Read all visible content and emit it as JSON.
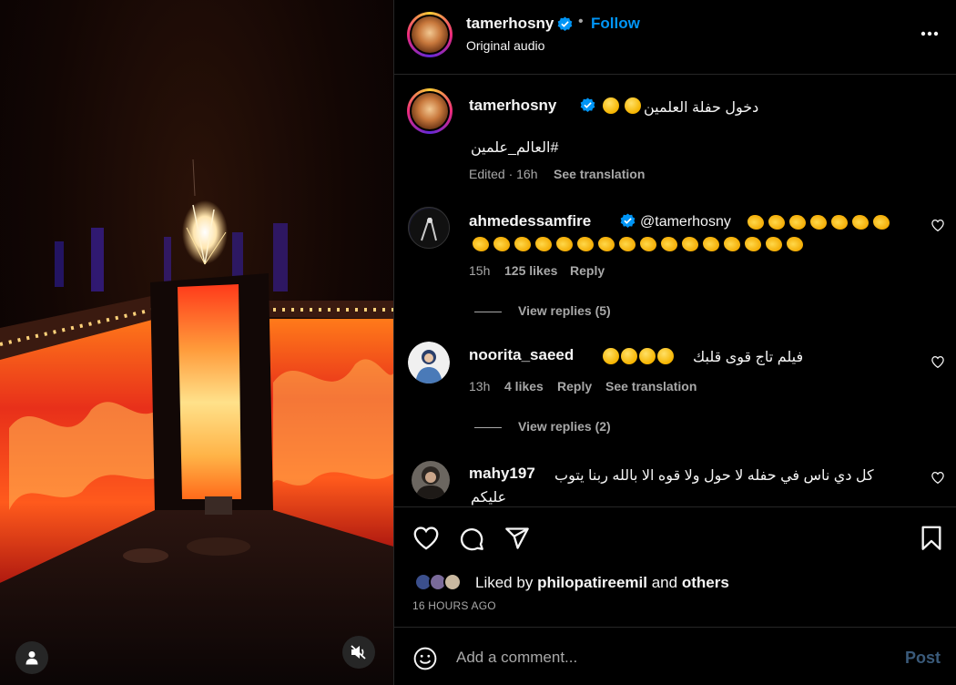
{
  "post": {
    "author": "tamerhosny",
    "follow_label": "Follow",
    "separator": "•",
    "audio": "Original audio"
  },
  "caption": {
    "author": "tamerhosny",
    "text": "دخول حفلة العلمين",
    "hashtag": "#العالم_علمين",
    "edited": "Edited · 16h",
    "see_translation": "See translation"
  },
  "comments": [
    {
      "user": "ahmedessamfire",
      "mention": "@tamerhosny",
      "time": "15h",
      "likes": "125 likes",
      "reply": "Reply",
      "view_replies": "View replies (5)"
    },
    {
      "user": "noorita_saeed",
      "text": "فيلم تاج قوى قلبك",
      "time": "13h",
      "likes": "4 likes",
      "reply": "Reply",
      "see_translation": "See translation",
      "view_replies": "View replies (2)"
    },
    {
      "user": "mahy197",
      "text_line1": "كل دي ناس في حفله لا حول ولا قوه الا بالله ربنا يتوب",
      "text_line2": "عليكم"
    }
  ],
  "likes": {
    "prefix": "Liked by",
    "user": "philopatireemil",
    "and": "and",
    "others": "others",
    "timestamp": "16 HOURS AGO"
  },
  "composer": {
    "placeholder": "Add a comment...",
    "post_label": "Post"
  },
  "colors": {
    "accent": "#0095f6",
    "verified": "#0095f6",
    "muted_text": "#a8a8a8",
    "divider": "#262626"
  },
  "icons": [
    "more-icon",
    "verified-icon",
    "heart-icon",
    "comment-icon",
    "share-icon",
    "bookmark-icon",
    "emoji-icon",
    "user-tag-icon",
    "mute-icon"
  ]
}
